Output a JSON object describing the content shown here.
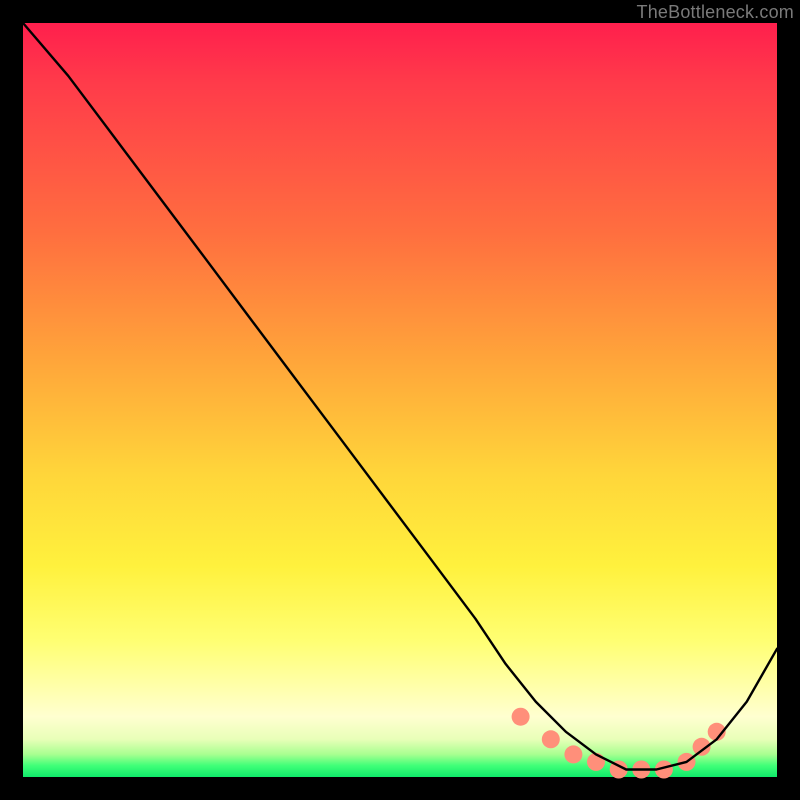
{
  "watermark": "TheBottleneck.com",
  "chart_data": {
    "type": "line",
    "title": "",
    "xlabel": "",
    "ylabel": "",
    "xlim": [
      0,
      100
    ],
    "ylim": [
      0,
      100
    ],
    "grid": false,
    "legend": false,
    "series": [
      {
        "name": "curve",
        "color": "#000000",
        "x": [
          0,
          6,
          12,
          18,
          24,
          30,
          36,
          42,
          48,
          54,
          60,
          64,
          68,
          72,
          76,
          80,
          84,
          88,
          92,
          96,
          100
        ],
        "y": [
          100,
          93,
          85,
          77,
          69,
          61,
          53,
          45,
          37,
          29,
          21,
          15,
          10,
          6,
          3,
          1,
          1,
          2,
          5,
          10,
          17
        ]
      }
    ],
    "markers": {
      "name": "highlight-dots",
      "color": "#ff8f7a",
      "radius": 9,
      "x": [
        66,
        70,
        73,
        76,
        79,
        82,
        85,
        88,
        90,
        92
      ],
      "y": [
        8,
        5,
        3,
        2,
        1,
        1,
        1,
        2,
        4,
        6
      ]
    }
  }
}
